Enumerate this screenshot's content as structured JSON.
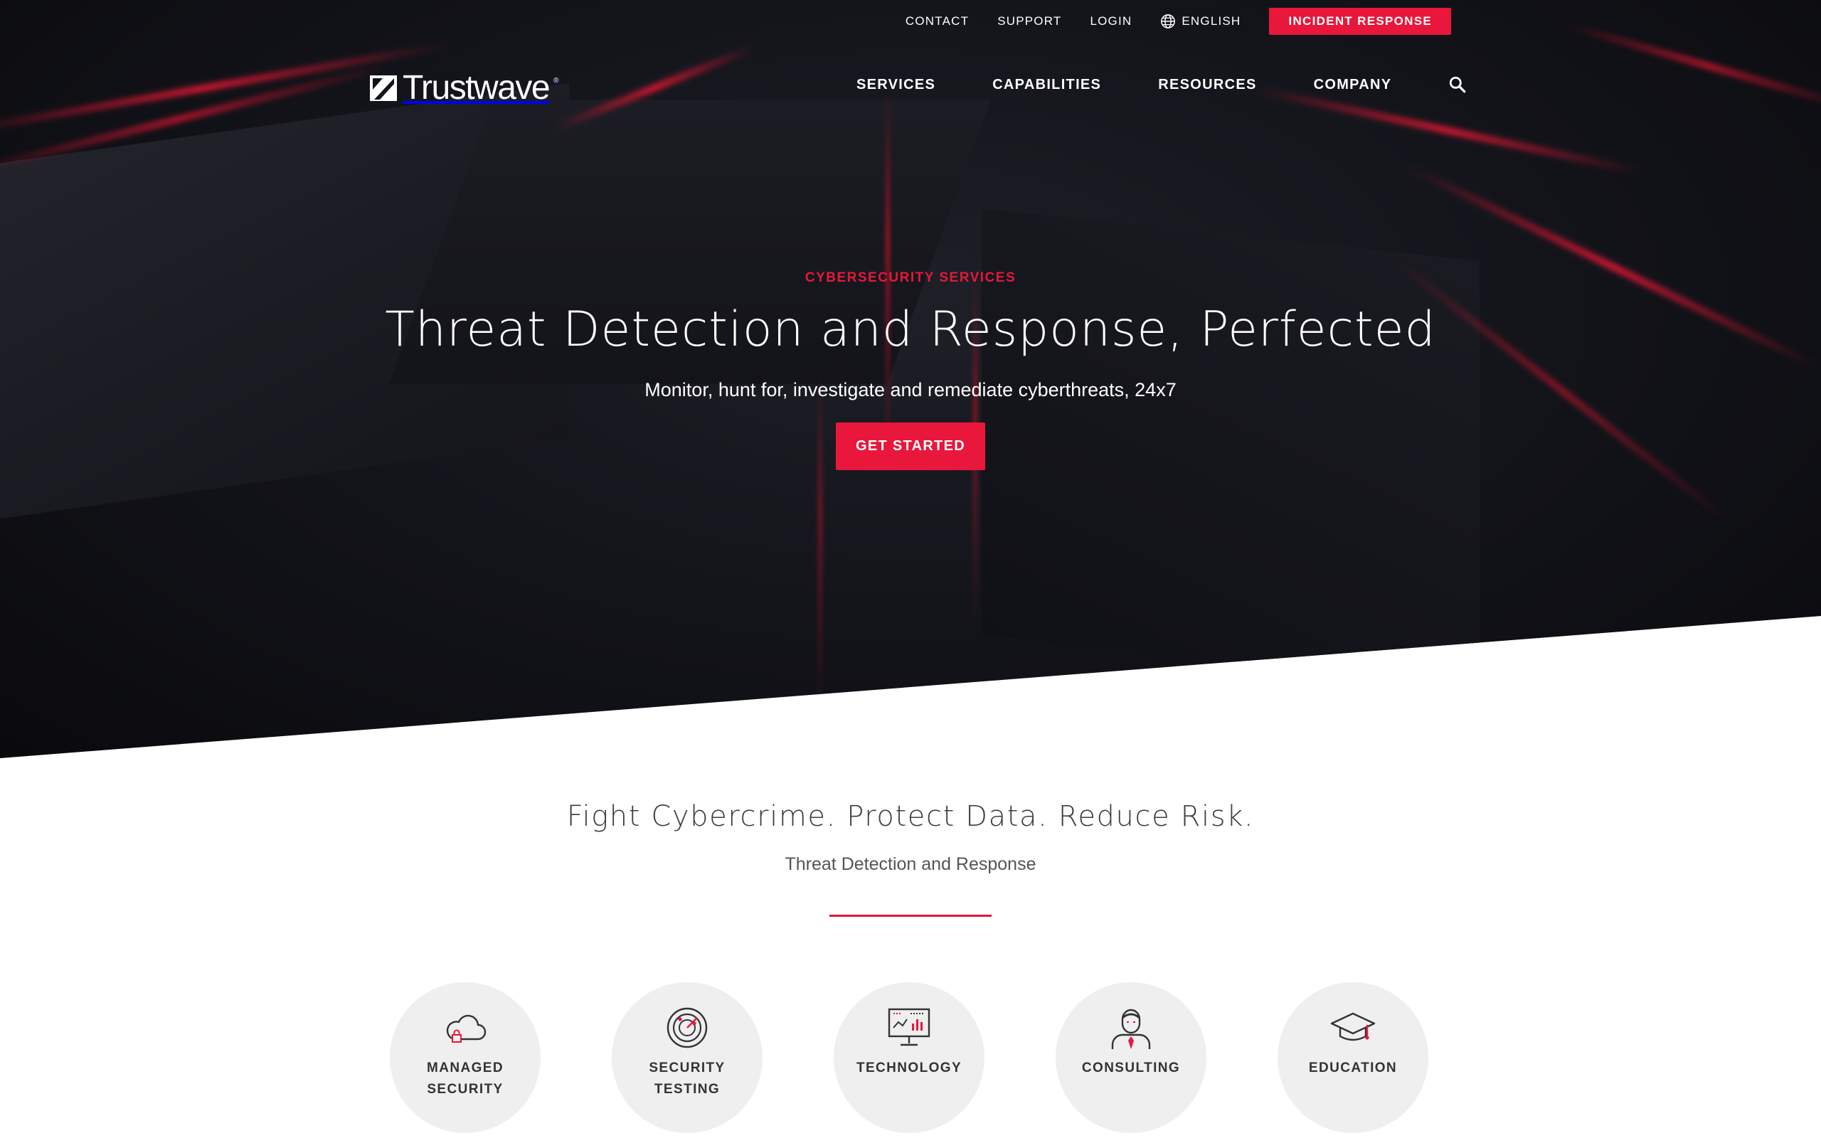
{
  "brand": {
    "name": "Trustwave",
    "registered": "®",
    "accent_color": "#e8173b"
  },
  "utility_nav": {
    "contact": "CONTACT",
    "support": "SUPPORT",
    "login": "LOGIN",
    "language": "ENGLISH",
    "incident_response": "INCIDENT RESPONSE"
  },
  "main_nav": {
    "items": [
      "SERVICES",
      "CAPABILITIES",
      "RESOURCES",
      "COMPANY"
    ],
    "search_icon": "search-icon"
  },
  "hero": {
    "eyebrow": "CYBERSECURITY SERVICES",
    "headline": "Threat Detection and Response, Perfected",
    "subhead": "Monitor, hunt for, investigate and remediate cyberthreats, 24x7",
    "cta": "GET STARTED"
  },
  "section": {
    "title": "Fight Cybercrime. Protect Data. Reduce Risk.",
    "subtitle": "Threat Detection and Response"
  },
  "cards": [
    {
      "line1": "MANAGED",
      "line2": "SECURITY",
      "icon": "cloud-lock-icon"
    },
    {
      "line1": "SECURITY",
      "line2": "TESTING",
      "icon": "target-icon"
    },
    {
      "line1": "TECHNOLOGY",
      "line2": "",
      "icon": "monitor-chart-icon"
    },
    {
      "line1": "CONSULTING",
      "line2": "",
      "icon": "consultant-icon"
    },
    {
      "line1": "EDUCATION",
      "line2": "",
      "icon": "graduation-cap-icon"
    }
  ]
}
